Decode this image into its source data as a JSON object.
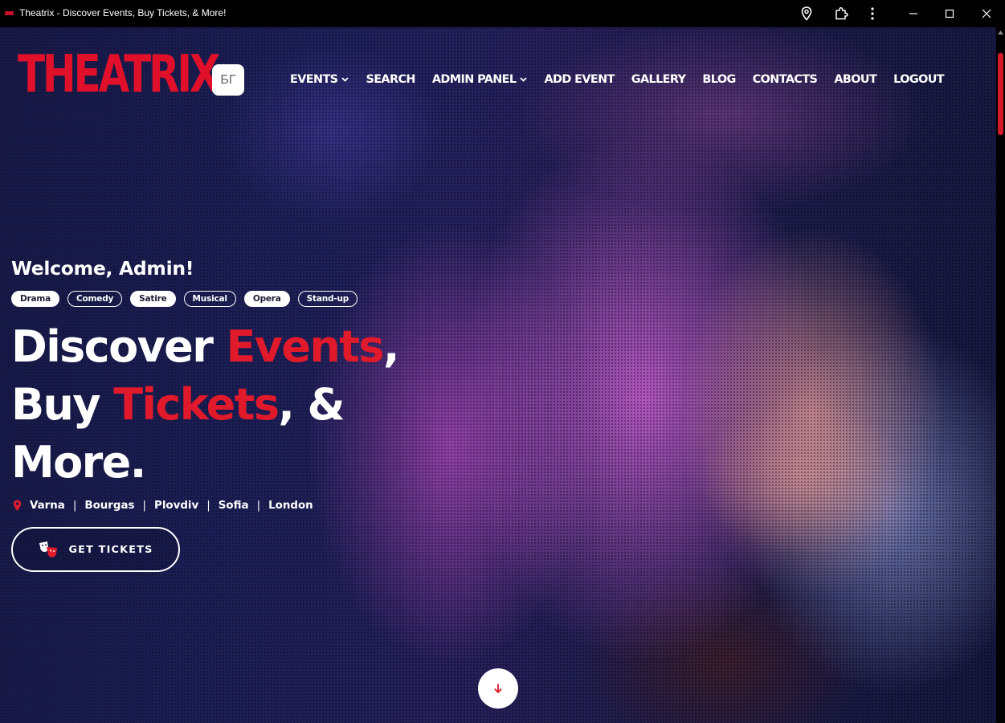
{
  "window": {
    "title": "Theatrix - Discover Events, Buy Tickets, & More!",
    "icons": [
      "location-icon",
      "extension-icon",
      "more-vertical-icon",
      "minimize-icon",
      "maximize-icon",
      "close-icon"
    ]
  },
  "header": {
    "logo_text": "THEATRIX",
    "language_button": "БГ",
    "nav": [
      {
        "label": "EVENTS",
        "dropdown": true
      },
      {
        "label": "SEARCH",
        "dropdown": false
      },
      {
        "label": "ADMIN PANEL",
        "dropdown": true
      },
      {
        "label": "ADD EVENT",
        "dropdown": false
      },
      {
        "label": "GALLERY",
        "dropdown": false
      },
      {
        "label": "BLOG",
        "dropdown": false
      },
      {
        "label": "CONTACTS",
        "dropdown": false
      },
      {
        "label": "ABOUT",
        "dropdown": false
      },
      {
        "label": "LOGOUT",
        "dropdown": false
      }
    ]
  },
  "hero": {
    "welcome": "Welcome, Admin!",
    "genres": [
      {
        "label": "Drama",
        "filled": true
      },
      {
        "label": "Comedy",
        "filled": false
      },
      {
        "label": "Satire",
        "filled": true
      },
      {
        "label": "Musical",
        "filled": false
      },
      {
        "label": "Opera",
        "filled": true
      },
      {
        "label": "Stand-up",
        "filled": false
      }
    ],
    "headline": {
      "line1_pre": "Discover ",
      "line1_accent": "Events",
      "line1_post": ",",
      "line2_pre": "Buy ",
      "line2_accent": "Tickets",
      "line2_post": ", &",
      "line3": "More."
    },
    "cities": [
      "Varna",
      "Bourgas",
      "Plovdiv",
      "Sofia",
      "London"
    ],
    "city_separator": "|",
    "cta_label": "GET TICKETS"
  },
  "colors": {
    "brand_red": "#e0102a",
    "accent_red": "#e11a2b",
    "scroll_thumb": "#d41b2a",
    "text_white": "#ffffff"
  }
}
